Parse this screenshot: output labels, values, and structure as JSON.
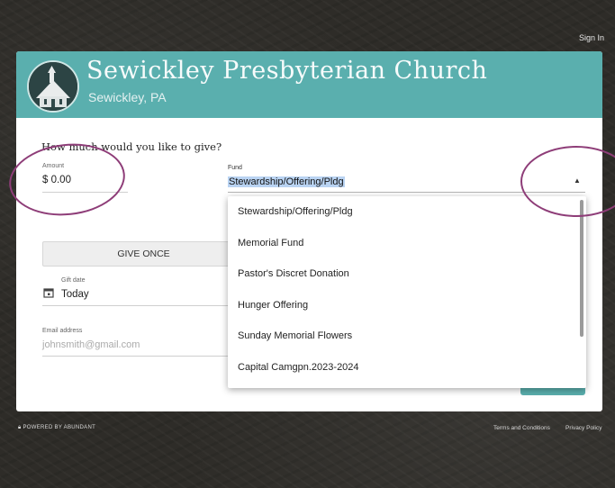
{
  "header": {
    "sign_in": "Sign In"
  },
  "church": {
    "name": "Sewickley Presbyterian Church",
    "location": "Sewickley, PA"
  },
  "form": {
    "question": "How much would you like to give?",
    "amount_label": "Amount",
    "amount_value": "$ 0.00",
    "fund_label": "Fund",
    "fund_value": "Stewardship/Offering/Pldg",
    "give_once_label": "GIVE ONCE",
    "gift_date_label": "Gift date",
    "gift_date_value": "Today",
    "email_label": "Email address",
    "email_placeholder": "johnsmith@gmail.com"
  },
  "fund_options": [
    "Stewardship/Offering/Pldg",
    "Memorial Fund",
    "Pastor's Discret Donation",
    "Hunger Offering",
    "Sunday Memorial Flowers",
    "Capital Camgpn.2023-2024"
  ],
  "footer": {
    "powered_by": "POWERED BY ABUNDANT",
    "terms": "Terms and Conditions",
    "privacy": "Privacy Policy"
  },
  "colors": {
    "brand_teal": "#5aafae",
    "annotation_circle": "#8e3d78",
    "selection_highlight": "#b9d3f2"
  }
}
